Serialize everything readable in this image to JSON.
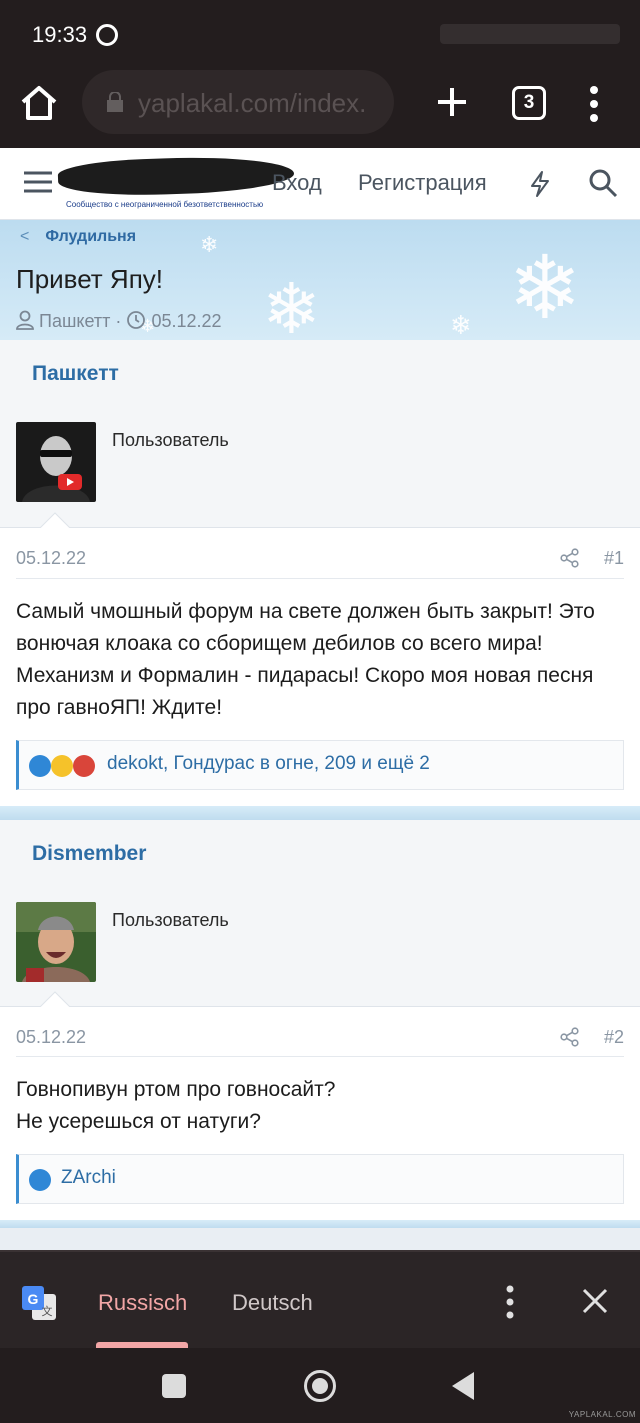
{
  "status_bar": {
    "time": "19:33"
  },
  "browser": {
    "url": "yaplakal.com/index.",
    "tab_count": "3"
  },
  "site_header": {
    "logo_subtitle": "Сообщество с неограниченной безответственностью",
    "login": "Вход",
    "register": "Регистрация"
  },
  "thread": {
    "breadcrumb": "Флудильня",
    "title": "Привет Япу!",
    "author": "Пашкетт",
    "separator": "·",
    "date": "05.12.22"
  },
  "posts": [
    {
      "username": "Пашкетт",
      "user_title": "Пользователь",
      "date": "05.12.22",
      "number": "#1",
      "text": "Самый чмошный форум на свете должен быть закрыт! Это вонючая клоака со сборищем дебилов со всего мира! Механизм и Формалин - пидарасы! Скоро моя новая песня про гавноЯП! Ждите!",
      "reactions": "dekokt, Гондурас в огне, 209 и ещё 2"
    },
    {
      "username": "Dismember",
      "user_title": "Пользователь",
      "date": "05.12.22",
      "number": "#2",
      "text_line1": "Говнопивун ртом про говносайт?",
      "text_line2": "Не усерешься от натуги?",
      "reactions": "ZArchi"
    }
  ],
  "translate_bar": {
    "active_lang": "Russisch",
    "other_lang": "Deutsch"
  },
  "watermark": "YAPLAKAL.COM",
  "colors": {
    "link": "#2d6da5",
    "accent": "#3a8dd0",
    "translate_active": "#f2a6a6"
  }
}
